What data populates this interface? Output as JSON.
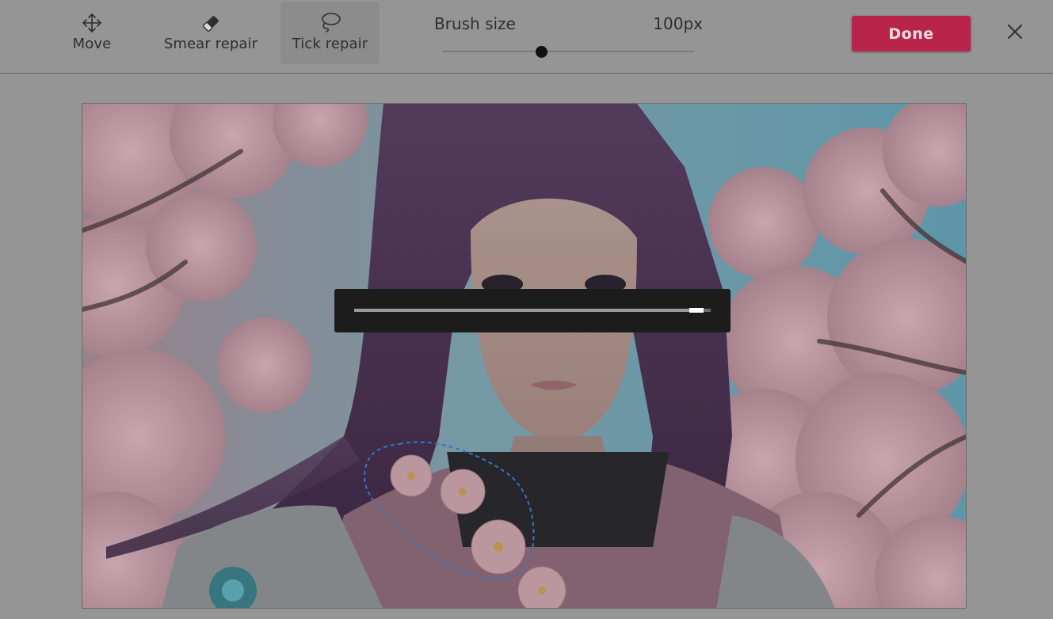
{
  "toolbar": {
    "tools": [
      {
        "label": "Move",
        "icon": "move-icon",
        "active": false
      },
      {
        "label": "Smear repair",
        "icon": "eraser-icon",
        "active": false
      },
      {
        "label": "Tick repair",
        "icon": "lasso-icon",
        "active": true
      }
    ],
    "brush": {
      "label": "Brush size",
      "value_text": "100px",
      "slider_fraction": 0.39
    },
    "done_label": "Done",
    "close_icon": "close-icon"
  },
  "canvas": {
    "image": "anime-girl-cherry-blossoms",
    "selection": "dashed-lasso-selection"
  },
  "progress": {
    "fraction": 0.98
  },
  "colors": {
    "accent": "#b8244a",
    "overlay": "#1c1c1c",
    "selection": "#3d7fd6"
  }
}
